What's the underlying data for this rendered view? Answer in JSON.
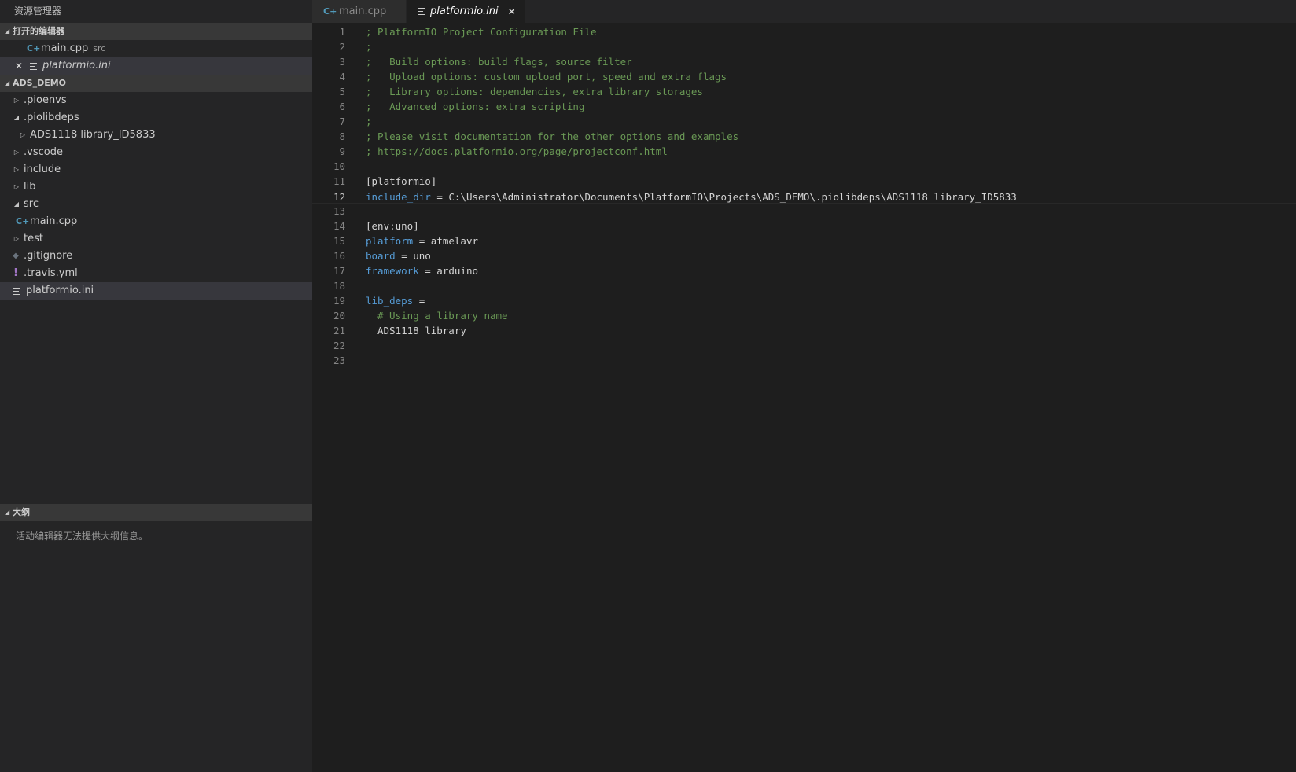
{
  "sidebar": {
    "title": "资源管理器",
    "open_editors": {
      "header": "打开的编辑器",
      "items": [
        {
          "label": "main.cpp",
          "desc": "src"
        },
        {
          "label": "platformio.ini"
        }
      ]
    },
    "project": {
      "header": "ADS_DEMO",
      "items": [
        {
          "label": ".pioenvs"
        },
        {
          "label": ".piolibdeps"
        },
        {
          "label": "ADS1118 library_ID5833"
        },
        {
          "label": ".vscode"
        },
        {
          "label": "include"
        },
        {
          "label": "lib"
        },
        {
          "label": "src"
        },
        {
          "label": "main.cpp"
        },
        {
          "label": "test"
        },
        {
          "label": ".gitignore"
        },
        {
          "label": ".travis.yml"
        },
        {
          "label": "platformio.ini"
        }
      ]
    },
    "outline": {
      "header": "大纲",
      "message": "活动编辑器无法提供大纲信息。"
    }
  },
  "tabs": [
    {
      "label": "main.cpp"
    },
    {
      "label": "platformio.ini"
    }
  ],
  "editor": {
    "current_line": 12,
    "lines": [
      {
        "n": "1",
        "parts": [
          {
            "c": "cm",
            "t": "; PlatformIO Project Configuration File"
          }
        ]
      },
      {
        "n": "2",
        "parts": [
          {
            "c": "cm",
            "t": ";"
          }
        ]
      },
      {
        "n": "3",
        "parts": [
          {
            "c": "cm",
            "t": ";   Build options: build flags, source filter"
          }
        ]
      },
      {
        "n": "4",
        "parts": [
          {
            "c": "cm",
            "t": ";   Upload options: custom upload port, speed and extra flags"
          }
        ]
      },
      {
        "n": "5",
        "parts": [
          {
            "c": "cm",
            "t": ";   Library options: dependencies, extra library storages"
          }
        ]
      },
      {
        "n": "6",
        "parts": [
          {
            "c": "cm",
            "t": ";   Advanced options: extra scripting"
          }
        ]
      },
      {
        "n": "7",
        "parts": [
          {
            "c": "cm",
            "t": ";"
          }
        ]
      },
      {
        "n": "8",
        "parts": [
          {
            "c": "cm",
            "t": "; Please visit documentation for the other options and examples"
          }
        ]
      },
      {
        "n": "9",
        "parts": [
          {
            "c": "cm",
            "t": "; "
          },
          {
            "c": "link",
            "t": "https://docs.platformio.org/page/projectconf.html"
          }
        ]
      },
      {
        "n": "10",
        "parts": []
      },
      {
        "n": "11",
        "parts": [
          {
            "c": "plain",
            "t": "[platformio]"
          }
        ]
      },
      {
        "n": "12",
        "parts": [
          {
            "c": "key",
            "t": "include_dir"
          },
          {
            "c": "plain",
            "t": " = C:\\Users\\Administrator\\Documents\\PlatformIO\\Projects\\ADS_DEMO\\.piolibdeps\\ADS1118 library_ID5833"
          }
        ]
      },
      {
        "n": "13",
        "parts": []
      },
      {
        "n": "14",
        "parts": [
          {
            "c": "plain",
            "t": "[env:uno]"
          }
        ]
      },
      {
        "n": "15",
        "parts": [
          {
            "c": "key",
            "t": "platform"
          },
          {
            "c": "plain",
            "t": " = atmelavr"
          }
        ]
      },
      {
        "n": "16",
        "parts": [
          {
            "c": "key",
            "t": "board"
          },
          {
            "c": "plain",
            "t": " = uno"
          }
        ]
      },
      {
        "n": "17",
        "parts": [
          {
            "c": "key",
            "t": "framework"
          },
          {
            "c": "plain",
            "t": " = arduino"
          }
        ]
      },
      {
        "n": "18",
        "parts": []
      },
      {
        "n": "19",
        "parts": [
          {
            "c": "key",
            "t": "lib_deps"
          },
          {
            "c": "plain",
            "t": " ="
          }
        ]
      },
      {
        "n": "20",
        "indent": true,
        "parts": [
          {
            "c": "cm",
            "t": "# Using a library name"
          }
        ]
      },
      {
        "n": "21",
        "indent": true,
        "parts": [
          {
            "c": "plain",
            "t": "ADS1118 library"
          }
        ]
      },
      {
        "n": "22",
        "parts": []
      },
      {
        "n": "23",
        "parts": []
      }
    ]
  }
}
